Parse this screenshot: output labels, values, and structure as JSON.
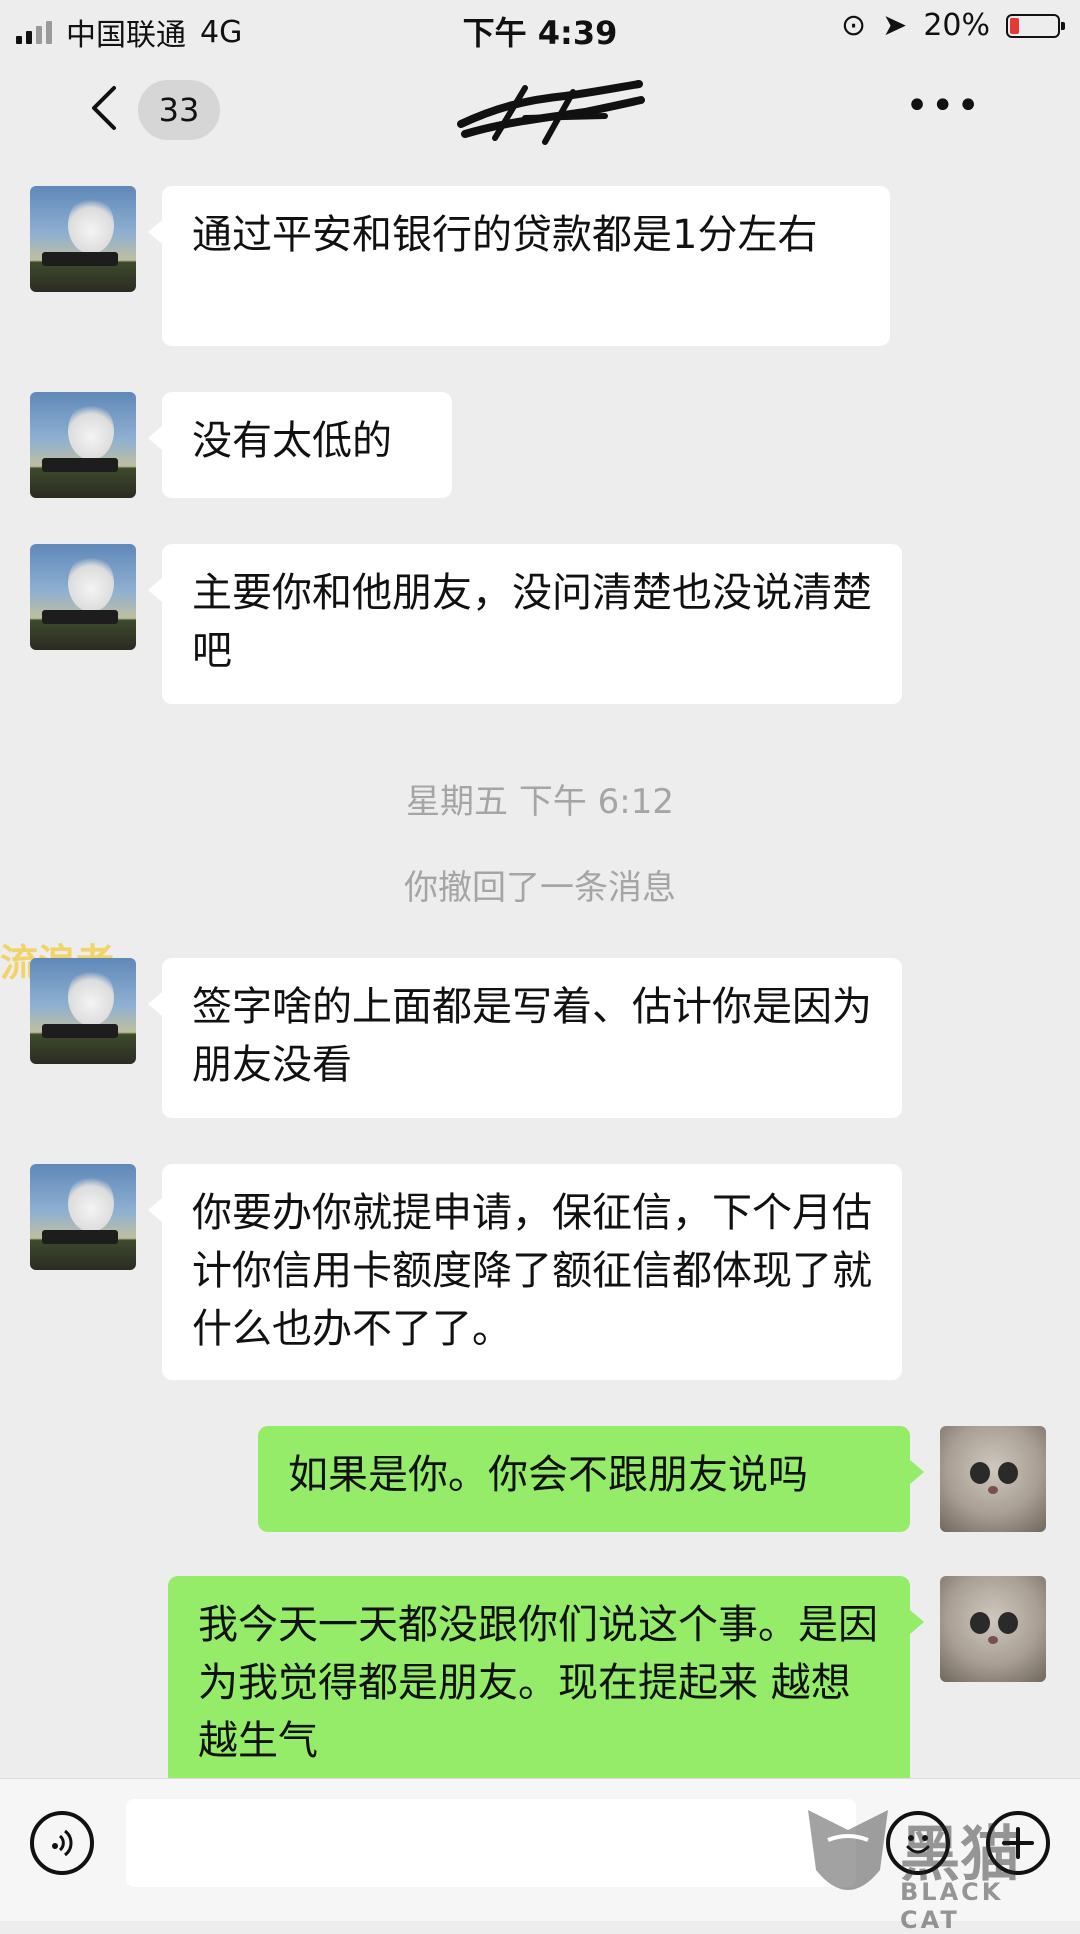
{
  "status_bar": {
    "carrier": "中国联通",
    "network": "4G",
    "time": "下午 4:39",
    "battery_percent": "20%",
    "battery_level": 0.2,
    "battery_color": "#e53935"
  },
  "nav": {
    "back_icon": "chevron-left",
    "unread_count": "33",
    "more_label": "•••"
  },
  "messages": [
    {
      "side": "left",
      "text": "通过平安和银行的贷款都是1分左右"
    },
    {
      "side": "left",
      "text": "没有太低的"
    },
    {
      "side": "left",
      "text": "主要你和他朋友，没问清楚也没说清楚吧"
    },
    {
      "side": "left",
      "text": "签字啥的上面都是写着、估计你是因为朋友没看"
    },
    {
      "side": "left",
      "text": "你要办你就提申请，保征信，下个月估计你信用卡额度降了额征信都体现了就什么也办不了了。"
    },
    {
      "side": "right",
      "text": "如果是你。你会不跟朋友说吗"
    },
    {
      "side": "right",
      "text": "我今天一天都没跟你们说这个事。是因为我觉得都是朋友。现在提起来 越想越生气"
    }
  ],
  "system": {
    "timestamp": "星期五 下午 6:12",
    "recall_notice": "你撤回了一条消息"
  },
  "watermark": {
    "overlay_text": "流浪者",
    "brand_cn": "黑猫",
    "brand_en": "BLACK CAT"
  },
  "input_bar": {
    "voice_icon": "voice-icon",
    "emoji_icon": "emoji-icon",
    "plus_icon": "plus-icon",
    "placeholder": ""
  },
  "colors": {
    "background": "#ededed",
    "bubble_incoming": "#ffffff",
    "bubble_outgoing": "#95ec69"
  }
}
